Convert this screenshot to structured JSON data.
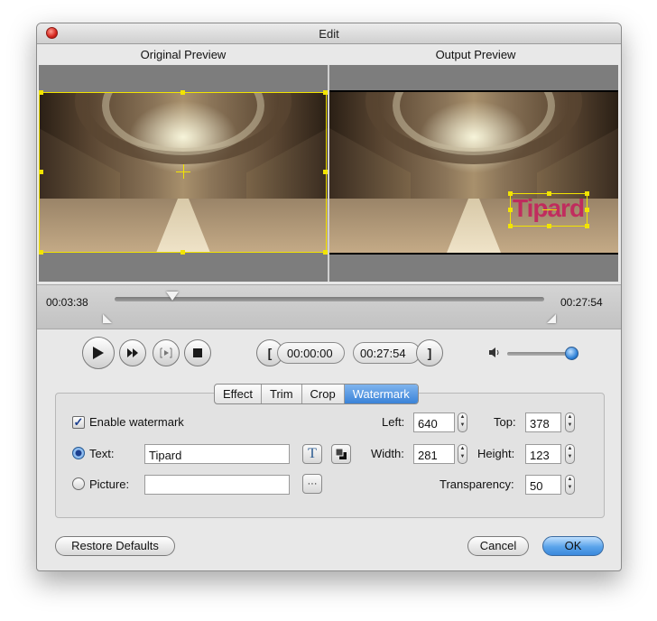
{
  "window": {
    "title": "Edit"
  },
  "preview": {
    "original_label": "Original Preview",
    "output_label": "Output Preview",
    "watermark_text": "Tipard"
  },
  "timeline": {
    "current_time": "00:03:38",
    "total_time": "00:27:54"
  },
  "playback": {
    "play_icon": "play-icon",
    "forward_icon": "fast-forward-icon",
    "step_icon": "step-frame-icon",
    "stop_icon": "stop-icon",
    "start_mark_label": "[",
    "start_time": "00:00:00",
    "end_time": "00:27:54",
    "end_mark_label": "]",
    "volume_icon": "speaker-icon",
    "volume_level": 0.9
  },
  "tabs": [
    {
      "label": "Effect",
      "active": false
    },
    {
      "label": "Trim",
      "active": false
    },
    {
      "label": "Crop",
      "active": false
    },
    {
      "label": "Watermark",
      "active": true
    }
  ],
  "watermark": {
    "enable_label": "Enable watermark",
    "enabled": true,
    "text_option_label": "Text:",
    "text_value": "Tipard",
    "text_font_button": "T",
    "picture_option_label": "Picture:",
    "picture_value": "",
    "browse_label": "···",
    "left_label": "Left:",
    "left_value": "640",
    "top_label": "Top:",
    "top_value": "378",
    "width_label": "Width:",
    "width_value": "281",
    "height_label": "Height:",
    "height_value": "123",
    "transparency_label": "Transparency:",
    "transparency_value": "50"
  },
  "footer": {
    "restore_label": "Restore Defaults",
    "cancel_label": "Cancel",
    "ok_label": "OK"
  },
  "colors": {
    "accent": "#3a83d8",
    "selection": "#f2e400",
    "watermark": "#c8145a"
  }
}
